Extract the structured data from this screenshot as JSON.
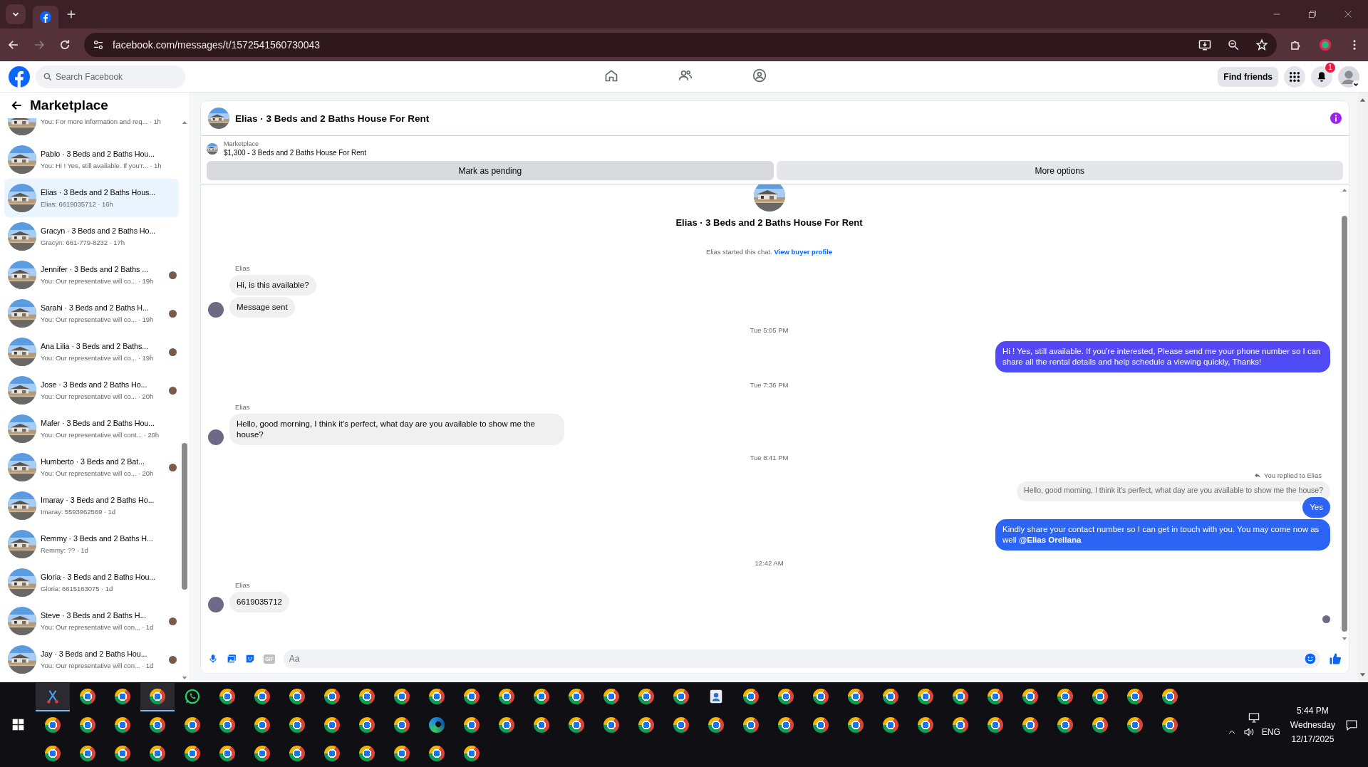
{
  "browser": {
    "tabs": [
      {
        "kind": "facebook",
        "selected": true
      }
    ],
    "url": "facebook.com/messages/t/1572541560730043"
  },
  "header": {
    "search": {
      "placeholder": "Search Facebook"
    },
    "nav": [
      {
        "kind": "home",
        "selected": false
      },
      {
        "kind": "friends",
        "selected": false
      },
      {
        "kind": "groups",
        "selected": false
      }
    ],
    "find_friends": "Find friends",
    "notifications_badge": "1"
  },
  "sidebar": {
    "title": "Marketplace",
    "conversations": [
      {
        "preview": "You: For more information and req... · 1h",
        "selected": false,
        "seen": false
      },
      {
        "title": "Pablo · 3 Beds and 2 Baths Hou...",
        "preview": "You: Hi ! Yes, still available. If you'r... · 1h",
        "selected": false,
        "seen": false
      },
      {
        "title": "Elias · 3 Beds and 2 Baths Hous...",
        "preview": "Elias: 6619035712 · 16h",
        "selected": true,
        "seen": false
      },
      {
        "title": "Gracyn · 3 Beds and 2 Baths Ho...",
        "preview": "Gracyn: 661-779-8232 · 17h",
        "selected": false,
        "seen": false
      },
      {
        "title": "Jennifer · 3 Beds and 2 Baths ...",
        "preview": "You: Our representative will co... · 19h",
        "selected": false,
        "seen": true
      },
      {
        "title": "Sarahi · 3 Beds and 2 Baths H...",
        "preview": "You: Our representative will co... · 19h",
        "selected": false,
        "seen": true
      },
      {
        "title": "Ana Lilia · 3 Beds and 2 Baths...",
        "preview": "You: Our representative will co... · 19h",
        "selected": false,
        "seen": true
      },
      {
        "title": "Jose · 3 Beds and 2 Baths Ho...",
        "preview": "You: Our representative will co... · 20h",
        "selected": false,
        "seen": true
      },
      {
        "title": "Mafer · 3 Beds and 2 Baths Hou...",
        "preview": "You: Our representative will cont... · 20h",
        "selected": false,
        "seen": false
      },
      {
        "title": "Humberto · 3 Beds and 2 Bat...",
        "preview": "You: Our representative will co... · 20h",
        "selected": false,
        "seen": true
      },
      {
        "title": "Imaray · 3 Beds and 2 Baths Ho...",
        "preview": "Imaray: 5593962569 · 1d",
        "selected": false,
        "seen": false
      },
      {
        "title": "Remmy · 3 Beds and 2 Baths H...",
        "preview": "Remmy: ?? · 1d",
        "selected": false,
        "seen": false
      },
      {
        "title": "Gloria · 3 Beds and 2 Baths Hou...",
        "preview": "Gloria: 6615163075 · 1d",
        "selected": false,
        "seen": false
      },
      {
        "title": "Steve · 3 Beds and 2 Baths H...",
        "preview": "You: Our representative will con... · 1d",
        "selected": false,
        "seen": true
      },
      {
        "title": "Jay · 3 Beds and 2 Baths Hou...",
        "preview": "You: Our representative will con... · 1d",
        "selected": false,
        "seen": true
      }
    ]
  },
  "chat": {
    "title": "Elias · 3 Beds and 2 Baths House For Rent",
    "listing": {
      "label": "Marketplace",
      "text": "$1,300 - 3 Beds and 2 Baths House For Rent"
    },
    "actions": [
      "Mark as pending",
      "More options"
    ],
    "intro_title": "Elias · 3 Beds and 2 Baths House For Rent",
    "started": {
      "text": "Elias started this chat.",
      "link": "View buyer profile"
    },
    "messages": [
      {
        "kind": "sender",
        "text": "Elias"
      },
      {
        "kind": "incoming",
        "text": "Hi, is this available?",
        "avatar": false
      },
      {
        "kind": "incoming",
        "text": "Message sent",
        "avatar": true
      },
      {
        "kind": "time",
        "text": "Tue 5:05 PM"
      },
      {
        "kind": "outgoing",
        "text": "Hi ! Yes, still available. If you're interested, Please send me your phone number so I can share all the rental details and help schedule a viewing quickly, Thanks!"
      },
      {
        "kind": "time",
        "text": "Tue 7:36 PM"
      },
      {
        "kind": "sender",
        "text": "Elias"
      },
      {
        "kind": "incoming",
        "text": "Hello, good morning, I think it's perfect, what day are you available to show me the house?",
        "avatar": true
      },
      {
        "kind": "time",
        "text": "Tue 8:41 PM"
      },
      {
        "kind": "reply-note",
        "text": "You replied to Elias"
      },
      {
        "kind": "quoted",
        "text": "Hello, good morning, I think it's perfect, what day are you available to show me the house?"
      },
      {
        "kind": "outgoing",
        "text": "Yes"
      },
      {
        "kind": "outgoing",
        "text": "Kindly share your contact number so I can get in touch with you. You may come now as well **@Elias Orellana**"
      },
      {
        "kind": "time",
        "text": "12:42 AM"
      },
      {
        "kind": "sender",
        "text": "Elias"
      },
      {
        "kind": "incoming",
        "text": "6619035712",
        "avatar": true
      },
      {
        "kind": "seen"
      }
    ],
    "composer": {
      "placeholder": "Aa",
      "gif_label": "GIF"
    }
  },
  "taskbar": {
    "rows": [
      {
        "items": [
          {
            "kind": "snip",
            "active": true
          },
          {
            "kind": "chrome",
            "active": false
          },
          {
            "kind": "chrome",
            "active": false
          },
          {
            "kind": "chrome",
            "active": true
          },
          {
            "kind": "whatsapp",
            "active": false
          },
          {
            "kind": "chrome",
            "active": false
          },
          {
            "kind": "chrome",
            "active": false
          },
          {
            "kind": "chrome",
            "active": false
          },
          {
            "kind": "chrome",
            "active": false
          },
          {
            "kind": "chrome",
            "active": false
          },
          {
            "kind": "chrome",
            "active": false
          },
          {
            "kind": "chrome",
            "active": false
          },
          {
            "kind": "chrome",
            "active": false
          },
          {
            "kind": "chrome",
            "active": false
          },
          {
            "kind": "chrome",
            "active": false
          },
          {
            "kind": "chrome",
            "active": false
          },
          {
            "kind": "chrome",
            "active": false
          },
          {
            "kind": "chrome",
            "active": false
          },
          {
            "kind": "chrome",
            "active": false
          },
          {
            "kind": "app",
            "active": false
          },
          {
            "kind": "chrome",
            "active": false
          },
          {
            "kind": "chrome",
            "active": false
          },
          {
            "kind": "chrome",
            "active": false
          },
          {
            "kind": "chrome",
            "active": false
          },
          {
            "kind": "chrome",
            "active": false
          },
          {
            "kind": "chrome",
            "active": false
          },
          {
            "kind": "chrome",
            "active": false
          },
          {
            "kind": "chrome",
            "active": false
          },
          {
            "kind": "chrome",
            "active": false
          },
          {
            "kind": "chrome",
            "active": false
          },
          {
            "kind": "chrome",
            "active": false
          },
          {
            "kind": "chrome",
            "active": false
          },
          {
            "kind": "chrome",
            "active": false
          }
        ]
      },
      {
        "items": [
          {
            "kind": "chrome",
            "active": false
          },
          {
            "kind": "chrome",
            "active": false
          },
          {
            "kind": "chrome",
            "active": false
          },
          {
            "kind": "chrome",
            "active": false
          },
          {
            "kind": "chrome",
            "active": false
          },
          {
            "kind": "chrome",
            "active": false
          },
          {
            "kind": "chrome",
            "active": false
          },
          {
            "kind": "chrome",
            "active": false
          },
          {
            "kind": "chrome",
            "active": false
          },
          {
            "kind": "chrome",
            "active": false
          },
          {
            "kind": "chrome",
            "active": false
          },
          {
            "kind": "edge",
            "active": false
          },
          {
            "kind": "chrome",
            "active": false
          },
          {
            "kind": "chrome",
            "active": false
          },
          {
            "kind": "chrome",
            "active": false
          },
          {
            "kind": "chrome",
            "active": false
          },
          {
            "kind": "chrome",
            "active": false
          },
          {
            "kind": "chrome",
            "active": false
          },
          {
            "kind": "chrome",
            "active": false
          },
          {
            "kind": "chrome",
            "active": false
          },
          {
            "kind": "chrome",
            "active": false
          },
          {
            "kind": "chrome",
            "active": false
          },
          {
            "kind": "chrome",
            "active": false
          },
          {
            "kind": "chrome",
            "active": false
          },
          {
            "kind": "chrome",
            "active": false
          },
          {
            "kind": "chrome",
            "active": false
          },
          {
            "kind": "chrome",
            "active": false
          },
          {
            "kind": "chrome",
            "active": false
          },
          {
            "kind": "chrome",
            "active": false
          },
          {
            "kind": "chrome",
            "active": false
          },
          {
            "kind": "chrome",
            "active": false
          },
          {
            "kind": "chrome",
            "active": false
          },
          {
            "kind": "chrome",
            "active": false
          }
        ]
      },
      {
        "items": [
          {
            "kind": "chrome",
            "active": false
          },
          {
            "kind": "chrome",
            "active": false
          },
          {
            "kind": "chrome",
            "active": false
          },
          {
            "kind": "chrome",
            "active": false
          },
          {
            "kind": "chrome",
            "active": false
          },
          {
            "kind": "chrome",
            "active": false
          },
          {
            "kind": "chrome",
            "active": false
          },
          {
            "kind": "chrome",
            "active": false
          },
          {
            "kind": "chrome",
            "active": false
          },
          {
            "kind": "chrome",
            "active": false
          },
          {
            "kind": "chrome",
            "active": false
          },
          {
            "kind": "chrome",
            "active": false
          },
          {
            "kind": "chrome",
            "active": false
          }
        ]
      }
    ],
    "tray": {
      "language": "ENG",
      "time": "5:44 PM",
      "day": "Wednesday",
      "date": "12/17/2025"
    }
  }
}
